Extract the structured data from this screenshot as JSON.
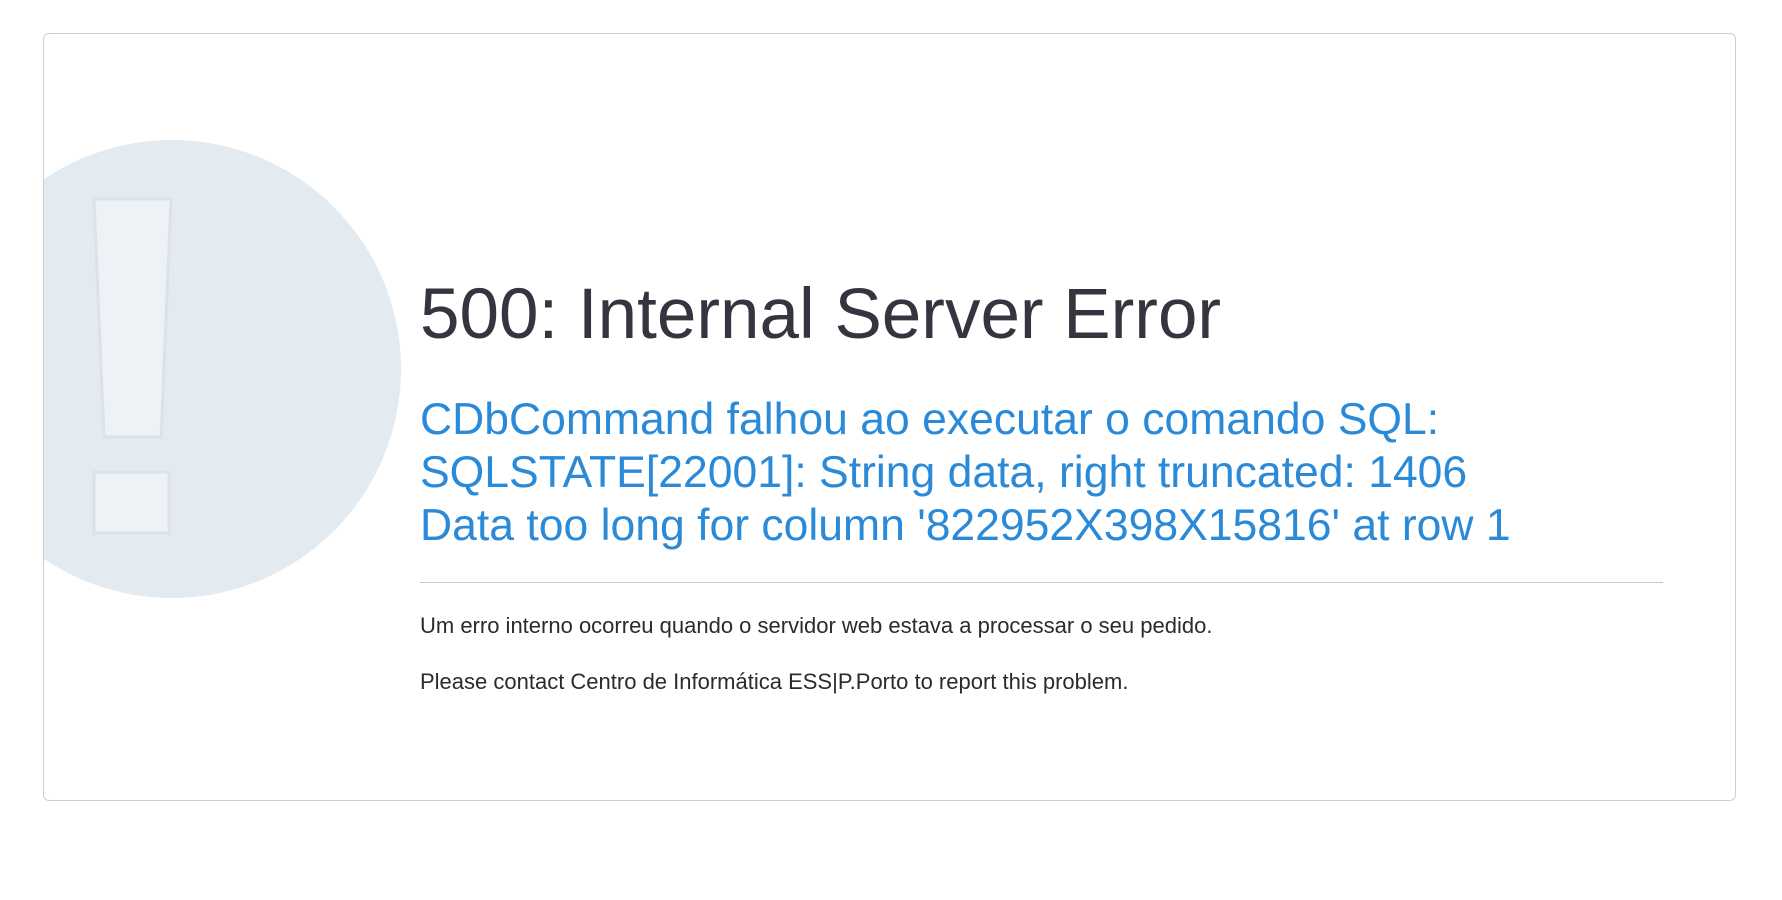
{
  "error": {
    "title": "500: Internal Server Error",
    "message_lines": [
      "CDbCommand falhou ao executar o comando SQL:",
      "SQLSTATE[22001]: String data, right truncated: 1406",
      "Data too long for column '822952X398X15816' at row 1"
    ],
    "description": "Um erro interno ocorreu quando o servidor web estava a processar o seu pedido.",
    "contact": "Please contact Centro de Informática ESS|P.Porto to report this problem."
  },
  "icons": {
    "background": "exclamation-circle-icon"
  },
  "colors": {
    "title": "#33353f",
    "message": "#2a8ad8",
    "icon_bg": "#e3eaf0",
    "text": "#2b2b2b"
  }
}
